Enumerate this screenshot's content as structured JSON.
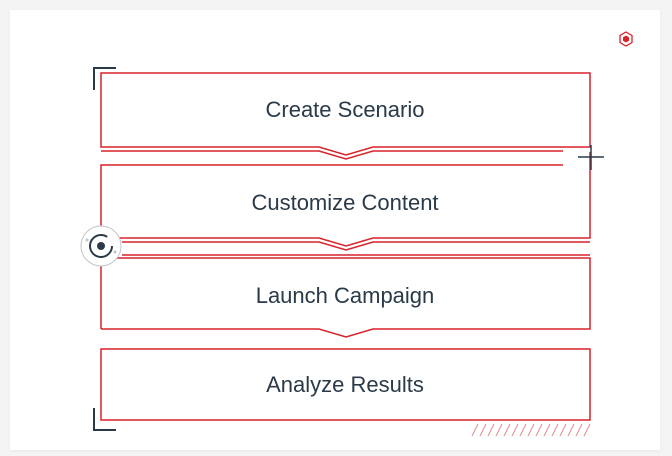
{
  "diagram": {
    "steps": [
      {
        "label": "Create Scenario"
      },
      {
        "label": "Customize Content"
      },
      {
        "label": "Launch Campaign"
      },
      {
        "label": "Analyze Results"
      }
    ]
  },
  "colors": {
    "accent": "#d8232a",
    "text": "#2a3a49",
    "bracket": "#2a3a49",
    "background": "#f4f4f4",
    "card": "#ffffff"
  },
  "icons": [
    "hexagon-badge-icon",
    "plus-crosshair-icon",
    "target-ring-icon",
    "corner-bracket-icon",
    "hatch-pattern-icon"
  ]
}
